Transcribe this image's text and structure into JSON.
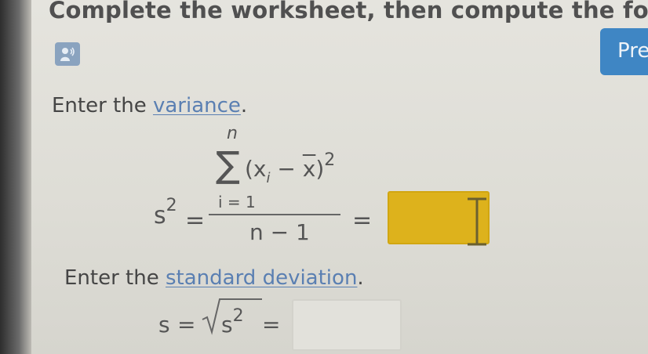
{
  "header": {
    "title": "Complete the worksheet, then compute the fo",
    "audio_icon": "speaker-icon",
    "prev_label": "Pre"
  },
  "variance": {
    "prompt_prefix": "Enter the ",
    "prompt_link": "variance",
    "prompt_suffix": ".",
    "lhs": "s",
    "lhs_exp": "2",
    "eq": "=",
    "sum_top": "n",
    "sum_symbol": "∑",
    "term_open": "(x",
    "term_sub": "i",
    "term_mid": " − ",
    "term_xbar": "x",
    "term_close": ")",
    "term_exp": "2",
    "sum_bottom": "i = 1",
    "denominator": "n − 1",
    "eq2": "=",
    "answer_value": ""
  },
  "stddev": {
    "prompt_prefix": "Enter the ",
    "prompt_link": "standard deviation",
    "prompt_suffix": ".",
    "lhs": "s",
    "eq": "=",
    "radicand": "s",
    "radicand_exp": "2",
    "eq2": "=",
    "answer_value": ""
  }
}
